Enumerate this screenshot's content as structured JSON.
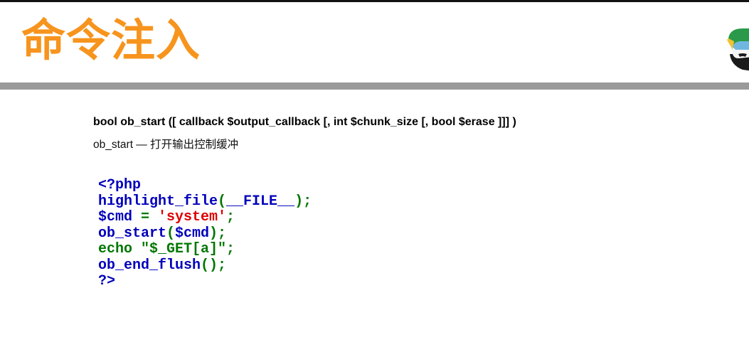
{
  "slide": {
    "title": "命令注入"
  },
  "doc": {
    "signature": "bool ob_start ([ callback $output_callback [, int $chunk_size [, bool $erase ]]] )",
    "description": "ob_start — 打开输出控制缓冲"
  },
  "colors": {
    "title": "#f7941d",
    "code_default": "#0000bb",
    "code_keyword": "#007700",
    "code_string": "#dd0000",
    "header_bar": "#9a9a9a"
  },
  "logo": {
    "icon": "helmet-logo-icon"
  },
  "code": {
    "lines": [
      [
        {
          "t": "<?php",
          "c": "#0000bb"
        }
      ],
      [
        {
          "t": "highlight_file",
          "c": "#0000bb"
        },
        {
          "t": "(",
          "c": "#007700"
        },
        {
          "t": "__FILE__",
          "c": "#0000bb"
        },
        {
          "t": ");",
          "c": "#007700"
        }
      ],
      [
        {
          "t": "$cmd ",
          "c": "#0000bb"
        },
        {
          "t": "= ",
          "c": "#007700"
        },
        {
          "t": "'system'",
          "c": "#dd0000"
        },
        {
          "t": ";",
          "c": "#007700"
        }
      ],
      [
        {
          "t": "ob_start",
          "c": "#0000bb"
        },
        {
          "t": "(",
          "c": "#007700"
        },
        {
          "t": "$cmd",
          "c": "#0000bb"
        },
        {
          "t": ");",
          "c": "#007700"
        }
      ],
      [
        {
          "t": "echo ",
          "c": "#007700"
        },
        {
          "t": "\"$_GET[a]\"",
          "c": "#007700"
        },
        {
          "t": ";",
          "c": "#007700"
        }
      ],
      [
        {
          "t": "ob_end_flush",
          "c": "#0000bb"
        },
        {
          "t": "();",
          "c": "#007700"
        }
      ],
      [
        {
          "t": "?>",
          "c": "#0000bb"
        }
      ]
    ]
  }
}
